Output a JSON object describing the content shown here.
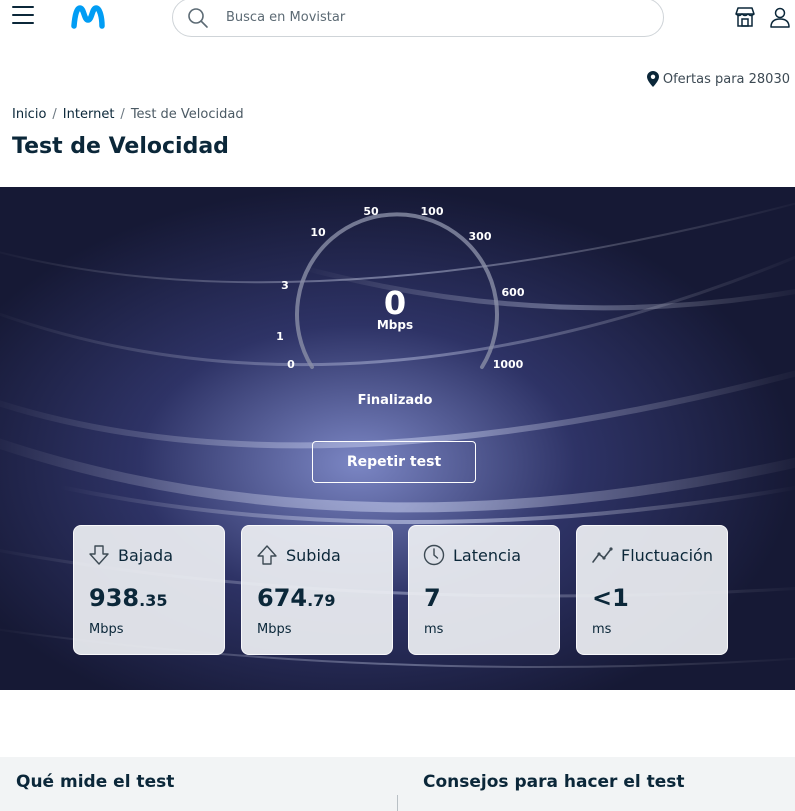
{
  "header": {
    "search_placeholder": "Busca en Movistar",
    "brand_color": "#019df4"
  },
  "offers": {
    "label": "Ofertas para 28030"
  },
  "breadcrumb": {
    "items": [
      "Inicio",
      "Internet"
    ],
    "current": "Test de Velocidad"
  },
  "page": {
    "title": "Test de Velocidad"
  },
  "speedtest": {
    "scale": [
      "0",
      "1",
      "3",
      "10",
      "50",
      "100",
      "300",
      "600",
      "1000"
    ],
    "value": "0",
    "unit": "Mbps",
    "status": "Finalizado",
    "repeat_label": "Repetir test"
  },
  "results": [
    {
      "label": "Bajada",
      "value": "938",
      "decimals": ".35",
      "unit": "Mbps",
      "icon": "arrow-down-icon"
    },
    {
      "label": "Subida",
      "value": "674",
      "decimals": ".79",
      "unit": "Mbps",
      "icon": "arrow-up-icon"
    },
    {
      "label": "Latencia",
      "value": "7",
      "decimals": "",
      "unit": "ms",
      "icon": "clock-icon"
    },
    {
      "label": "Fluctuación",
      "value": "<1",
      "decimals": "",
      "unit": "ms",
      "icon": "chart-line-icon"
    }
  ],
  "info": {
    "left_title": "Qué mide el test",
    "right_title": "Consejos para hacer el test"
  }
}
